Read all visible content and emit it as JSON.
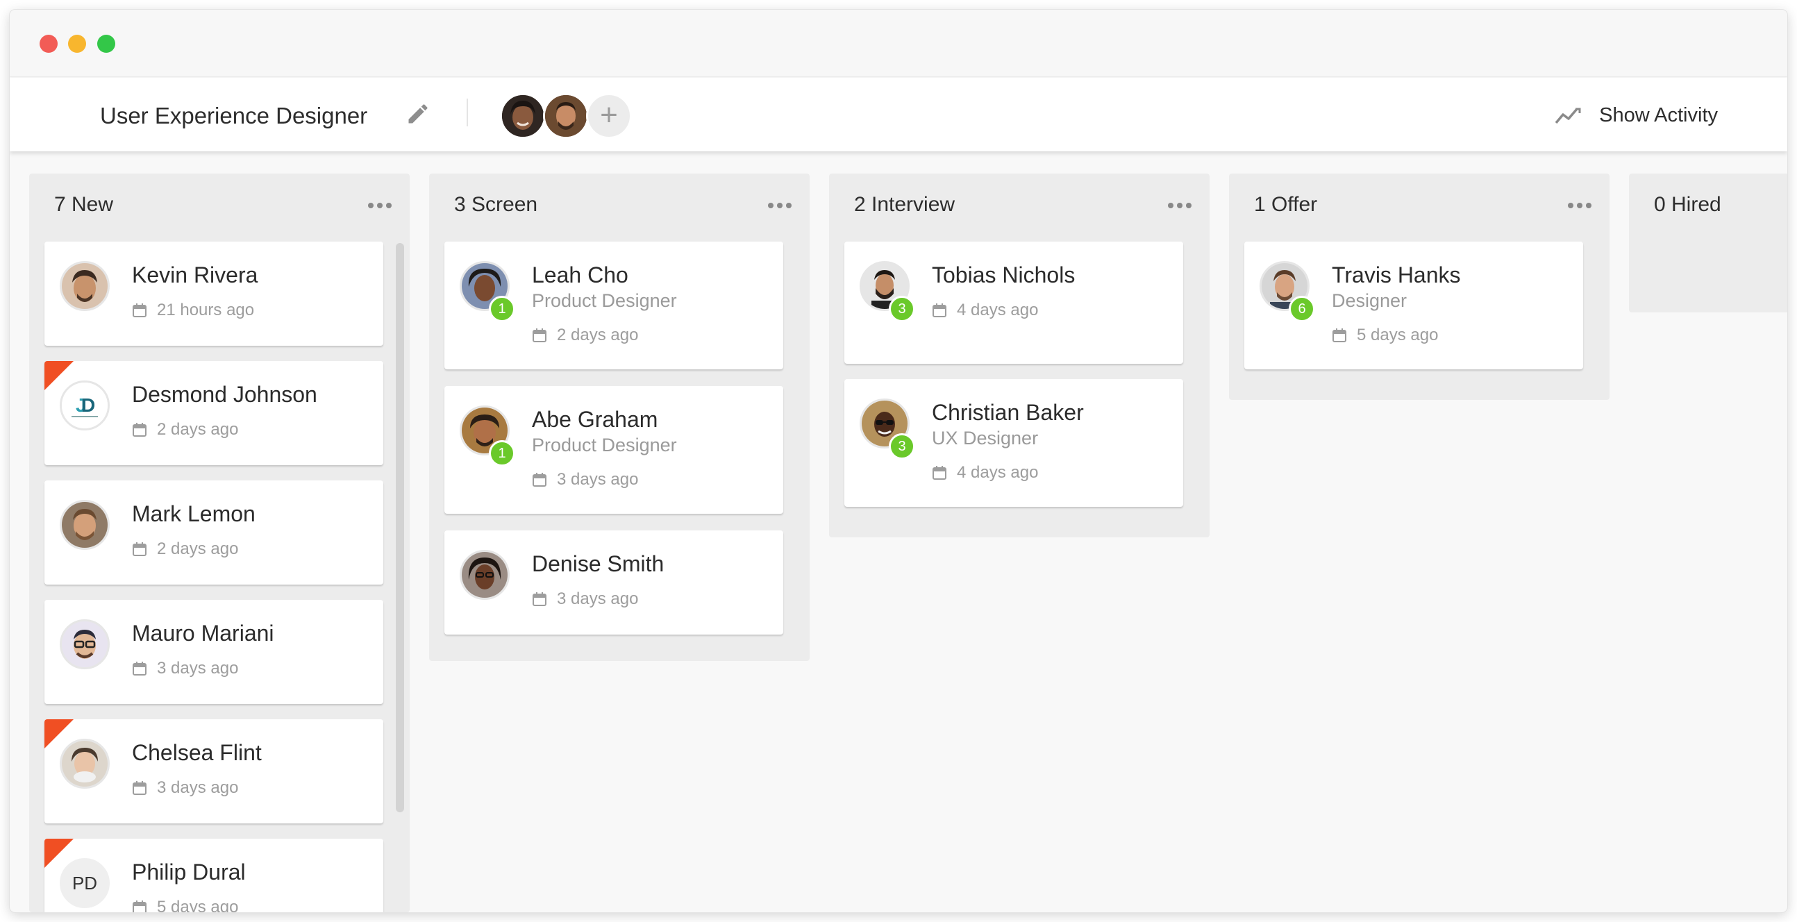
{
  "header": {
    "job_title": "User Experience Designer",
    "add_member_symbol": "+",
    "activity_label": "Show Activity"
  },
  "colors": {
    "accent_green": "#6ac92a",
    "flag_red": "#f04f23",
    "column_bg": "#ececec"
  },
  "icons": [
    "pencil-icon",
    "activity-trend-icon",
    "calendar-icon",
    "more-dots-icon",
    "plus-icon"
  ],
  "columns": [
    {
      "title": "7 New",
      "cards": [
        {
          "name": "Kevin Rivera",
          "role": "",
          "time": "21 hours ago"
        },
        {
          "name": "Desmond Johnson",
          "role": "",
          "time": "2 days ago",
          "flagged": true
        },
        {
          "name": "Mark Lemon",
          "role": "",
          "time": "2 days ago"
        },
        {
          "name": "Mauro Mariani",
          "role": "",
          "time": "3 days ago"
        },
        {
          "name": "Chelsea Flint",
          "role": "",
          "time": "3 days ago",
          "flagged": true
        },
        {
          "name": "Philip Dural",
          "role": "",
          "time": "5 days ago",
          "flagged": true,
          "initials": "PD"
        }
      ]
    },
    {
      "title": "3 Screen",
      "cards": [
        {
          "name": "Leah Cho",
          "role": "Product Designer",
          "time": "2 days ago",
          "badge": "1"
        },
        {
          "name": "Abe Graham",
          "role": "Product Designer",
          "time": "3 days ago",
          "badge": "1"
        },
        {
          "name": "Denise Smith",
          "role": "",
          "time": "3 days ago"
        }
      ]
    },
    {
      "title": "2 Interview",
      "cards": [
        {
          "name": "Tobias Nichols",
          "role": "",
          "time": "4 days ago",
          "badge": "3"
        },
        {
          "name": "Christian Baker",
          "role": "UX Designer",
          "time": "4 days ago",
          "badge": "3"
        }
      ]
    },
    {
      "title": "1 Offer",
      "cards": [
        {
          "name": "Travis Hanks",
          "role": "Designer",
          "time": "5 days ago",
          "badge": "6"
        }
      ]
    },
    {
      "title": "0 Hired",
      "cards": []
    }
  ]
}
